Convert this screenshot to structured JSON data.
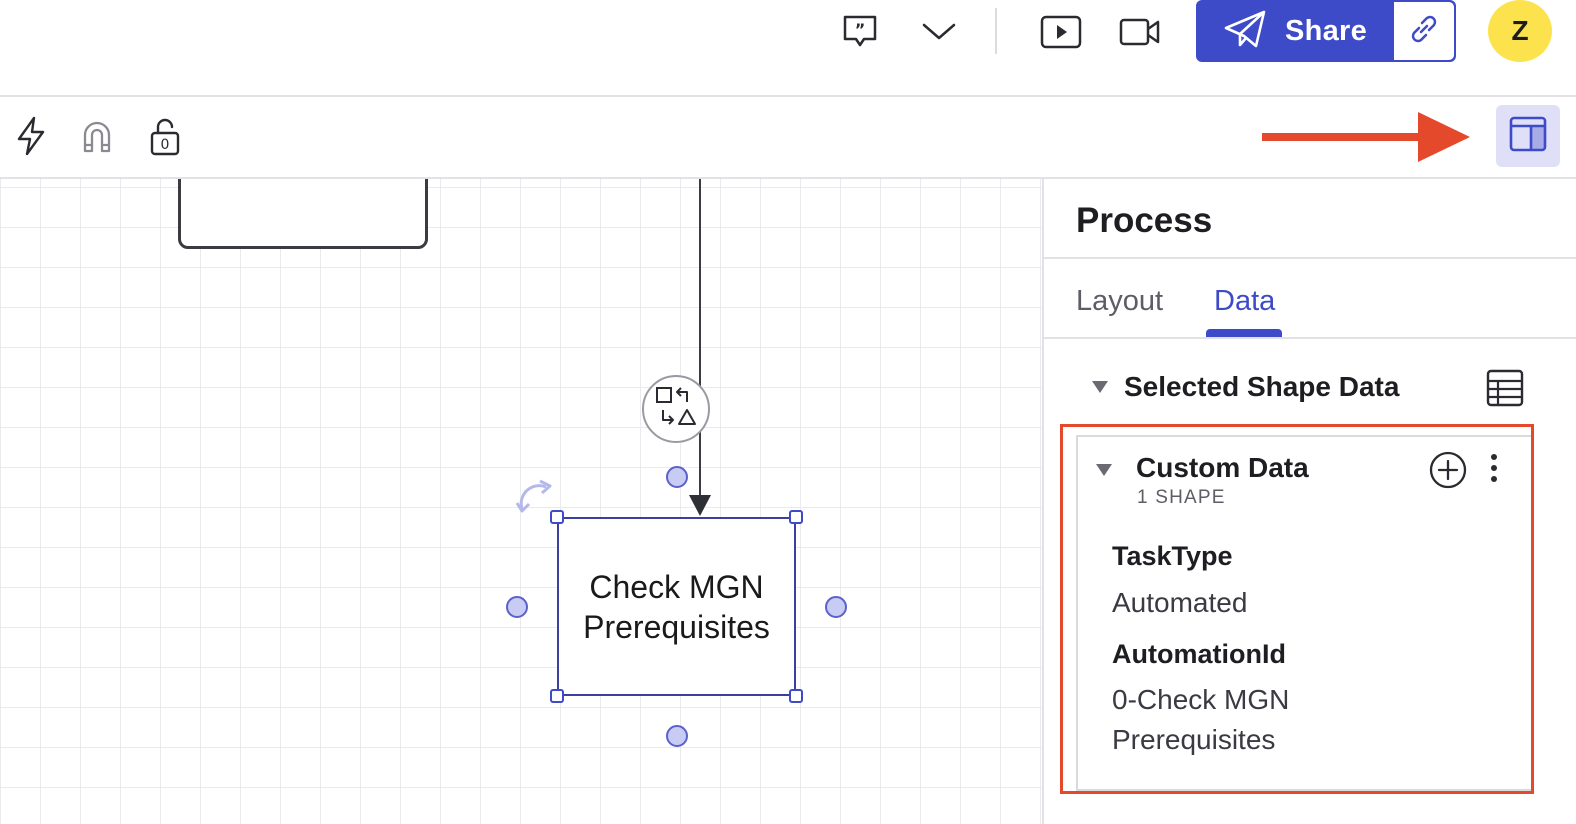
{
  "header": {
    "share_label": "Share",
    "avatar_initial": "Z",
    "icons": [
      "comment-icon",
      "chevron-down-icon",
      "present-icon",
      "video-icon",
      "paper-plane-icon",
      "link-icon"
    ]
  },
  "toolbar": {
    "icons": [
      "lightning-icon",
      "magnet-icon",
      "lock-icon",
      "panel-layout-icon"
    ],
    "lock_count": "0"
  },
  "canvas": {
    "shape_text_line1": "Check MGN",
    "shape_text_line2": "Prerequisites"
  },
  "panel": {
    "title": "Process",
    "tabs": [
      {
        "label": "Layout",
        "active": false
      },
      {
        "label": "Data",
        "active": true
      }
    ],
    "section_title": "Selected Shape Data",
    "custom_data": {
      "title": "Custom Data",
      "subtitle": "1 SHAPE",
      "fields": [
        {
          "label": "TaskType",
          "value": "Automated"
        },
        {
          "label": "AutomationId",
          "value_line1": "0-Check MGN",
          "value_line2": "Prerequisites"
        }
      ]
    }
  },
  "colors": {
    "accent": "#3e4bc8",
    "annotation": "#e4492b",
    "avatar": "#fce34d",
    "handle_fill": "#c8cbf3"
  }
}
